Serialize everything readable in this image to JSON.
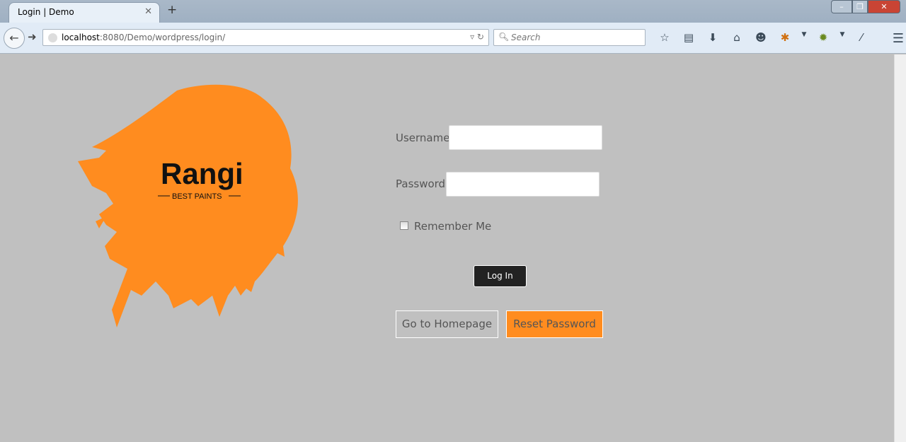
{
  "browser": {
    "tab_title": "Login | Demo",
    "url_host": "localhost",
    "url_path": ":8080/Demo/wordpress/login/",
    "search_placeholder": "Search",
    "toolbar_icons": [
      "star-icon",
      "reading-list-icon",
      "download-icon",
      "home-icon",
      "chat-icon",
      "firebug-icon",
      "dropdown-icon",
      "addon-icon",
      "dropdown-icon",
      "pin-icon",
      "menu-icon"
    ]
  },
  "logo": {
    "name": "Rangi",
    "tagline": "BEST PAINTS",
    "color": "#ff8c1f"
  },
  "form": {
    "username_label": "Username",
    "username_value": "",
    "password_label": "Password",
    "password_value": "",
    "remember_label": "Remember Me",
    "remember_checked": false,
    "login_label": "Log In",
    "homepage_label": "Go to Homepage",
    "reset_label": "Reset Password"
  },
  "colors": {
    "background": "#c0c0c0",
    "accent": "#ff8c1f",
    "login_button": "#222222"
  }
}
